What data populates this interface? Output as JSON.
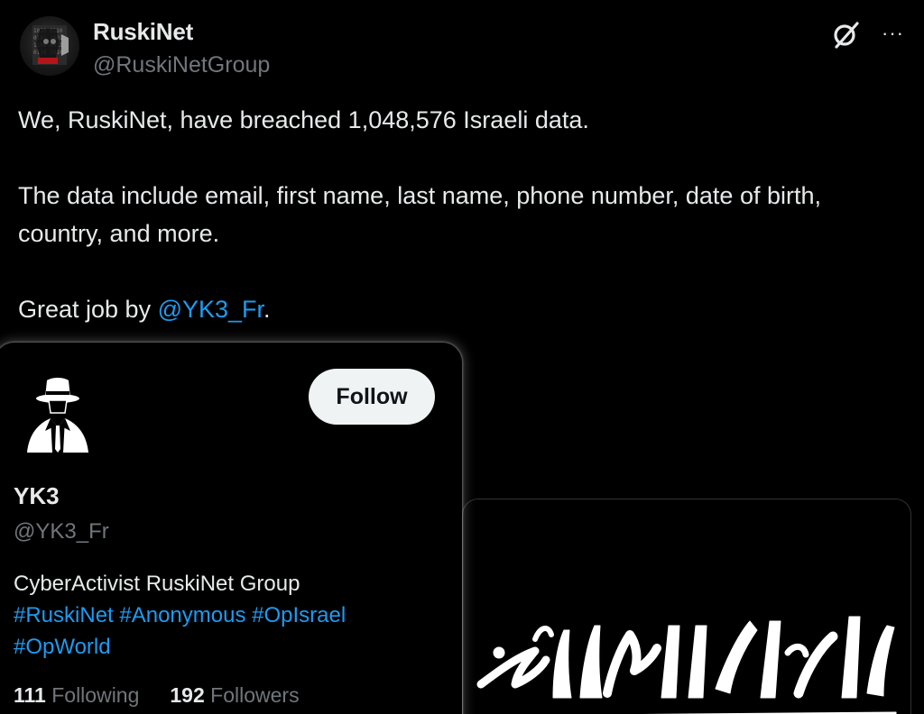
{
  "tweet": {
    "author_name": "RuskiNet",
    "author_handle": "@RuskiNetGroup",
    "paragraph_1": "We, RuskiNet, have breached 1,048,576 Israeli data.",
    "paragraph_2": "The data include email, first name, last name, phone number, date of birth, country, and more.",
    "paragraph_3_prefix": "Great job by ",
    "paragraph_3_mention": "@YK3_Fr",
    "paragraph_3_suffix": ".",
    "more_icon_glyph": "···"
  },
  "icons": {
    "grok": "grok-icon",
    "more": "more-icon",
    "author_avatar": "hacker-avatar",
    "profile_avatar": "anonymous-suit-avatar"
  },
  "profile_card": {
    "follow_label": "Follow",
    "name": "YK3",
    "handle": "@YK3_Fr",
    "bio_text": "CyberActivist RuskiNet Group",
    "hashtags_line1": "#RuskiNet #Anonymous #OpIsrael",
    "hashtags_line2": "#OpWorld",
    "following_count": "111",
    "following_label": "Following",
    "followers_count": "192",
    "followers_label": "Followers"
  },
  "colors": {
    "background": "#000000",
    "text_primary": "#e7e9ea",
    "text_secondary": "#71767b",
    "link": "#1d9bf0",
    "button_bg": "#eff3f4"
  }
}
